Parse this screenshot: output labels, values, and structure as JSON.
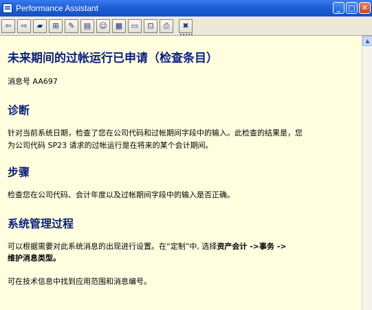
{
  "window": {
    "title": "Performance Assistant"
  },
  "window_controls": {
    "minimize": "_",
    "maximize": "□",
    "close": "✕"
  },
  "toolbar": {
    "buttons": [
      {
        "icon": "back-arrow-icon",
        "glyph": "⇦"
      },
      {
        "icon": "forward-arrow-icon",
        "glyph": "⇨"
      },
      {
        "icon": "book-icon",
        "glyph": "▰"
      },
      {
        "icon": "tree-icon",
        "glyph": "⊞"
      },
      {
        "icon": "edit-icon",
        "glyph": "✎"
      },
      {
        "icon": "note-icon",
        "glyph": "▤"
      },
      {
        "icon": "person-icon",
        "glyph": "☺"
      },
      {
        "icon": "document-icon",
        "glyph": "▦"
      },
      {
        "icon": "window-icon",
        "glyph": "▭"
      },
      {
        "icon": "bookmark-icon",
        "glyph": "⊡"
      },
      {
        "icon": "print-icon",
        "glyph": "⎙"
      },
      {
        "icon": "close-icon",
        "glyph": "✖"
      }
    ]
  },
  "doc": {
    "title": "未来期间的过帐运行已申请（检查条目）",
    "message_no": "消息号  AA697",
    "diagnosis_heading": "诊断",
    "diagnosis_line1": "针对当前系统日期，检查了您在公司代码和过帐期间字段中的输入。此检查的结果是，您",
    "diagnosis_line2": "为公司代码  SP23 请求的过帐运行是在将来的某个会计期间。",
    "procedure_heading": "步骤",
    "procedure_text": "检查您在公司代码、会计年度以及过帐期间字段中的输入是否正确。",
    "sysadmin_heading": "系统管理过程",
    "sysadmin_line1_pre": "可以根据需要对此系统消息的出现进行设置。在“定制”中, 选择",
    "sysadmin_line1_bold": "资产会计  ->事务  ->",
    "sysadmin_line2_bold": "维护消息类型。",
    "tech_info": "可在技术信息中找到应用范围和消息编号。"
  }
}
